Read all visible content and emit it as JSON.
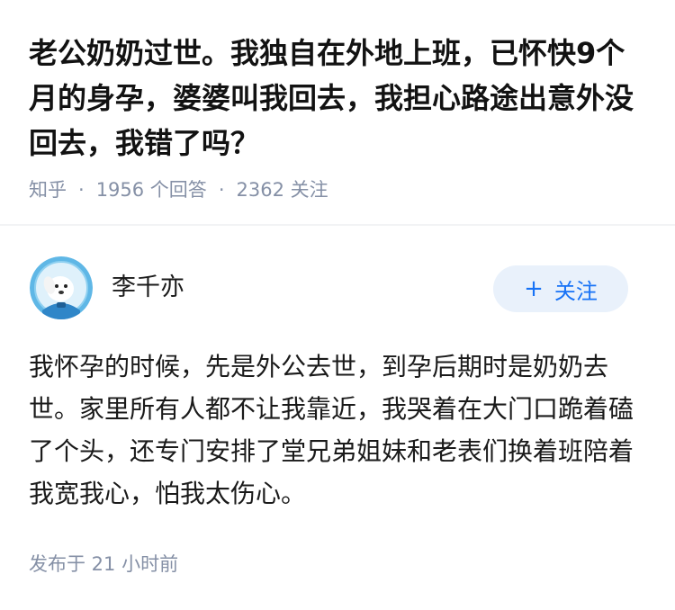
{
  "question": {
    "title": "老公奶奶过世。我独自在外地上班，已怀快9个月的身孕，婆婆叫我回去，我担心路途出意外没回去，我错了吗？",
    "meta": {
      "source": "知乎",
      "separator": "·",
      "answers": "1956 个回答",
      "followers": "2362 关注"
    }
  },
  "answer": {
    "author": {
      "name": "李千亦",
      "avatar_icon": "astronaut-dog-avatar"
    },
    "follow_button": {
      "label": "关注",
      "icon": "plus-icon"
    },
    "content": "我怀孕的时候，先是外公去世，到孕后期时是奶奶去世。家里所有人都不让我靠近，我哭着在大门口跪着磕了个头，还专门安排了堂兄弟姐妹和老表们换着班陪着我宽我心，怕我太伤心。",
    "published": "发布于  21 小时前"
  },
  "colors": {
    "accent": "#1772f6",
    "follow_bg": "#e9f1fb",
    "meta_gray": "#8590a6",
    "avatar_bg": "#5fb7e6"
  }
}
